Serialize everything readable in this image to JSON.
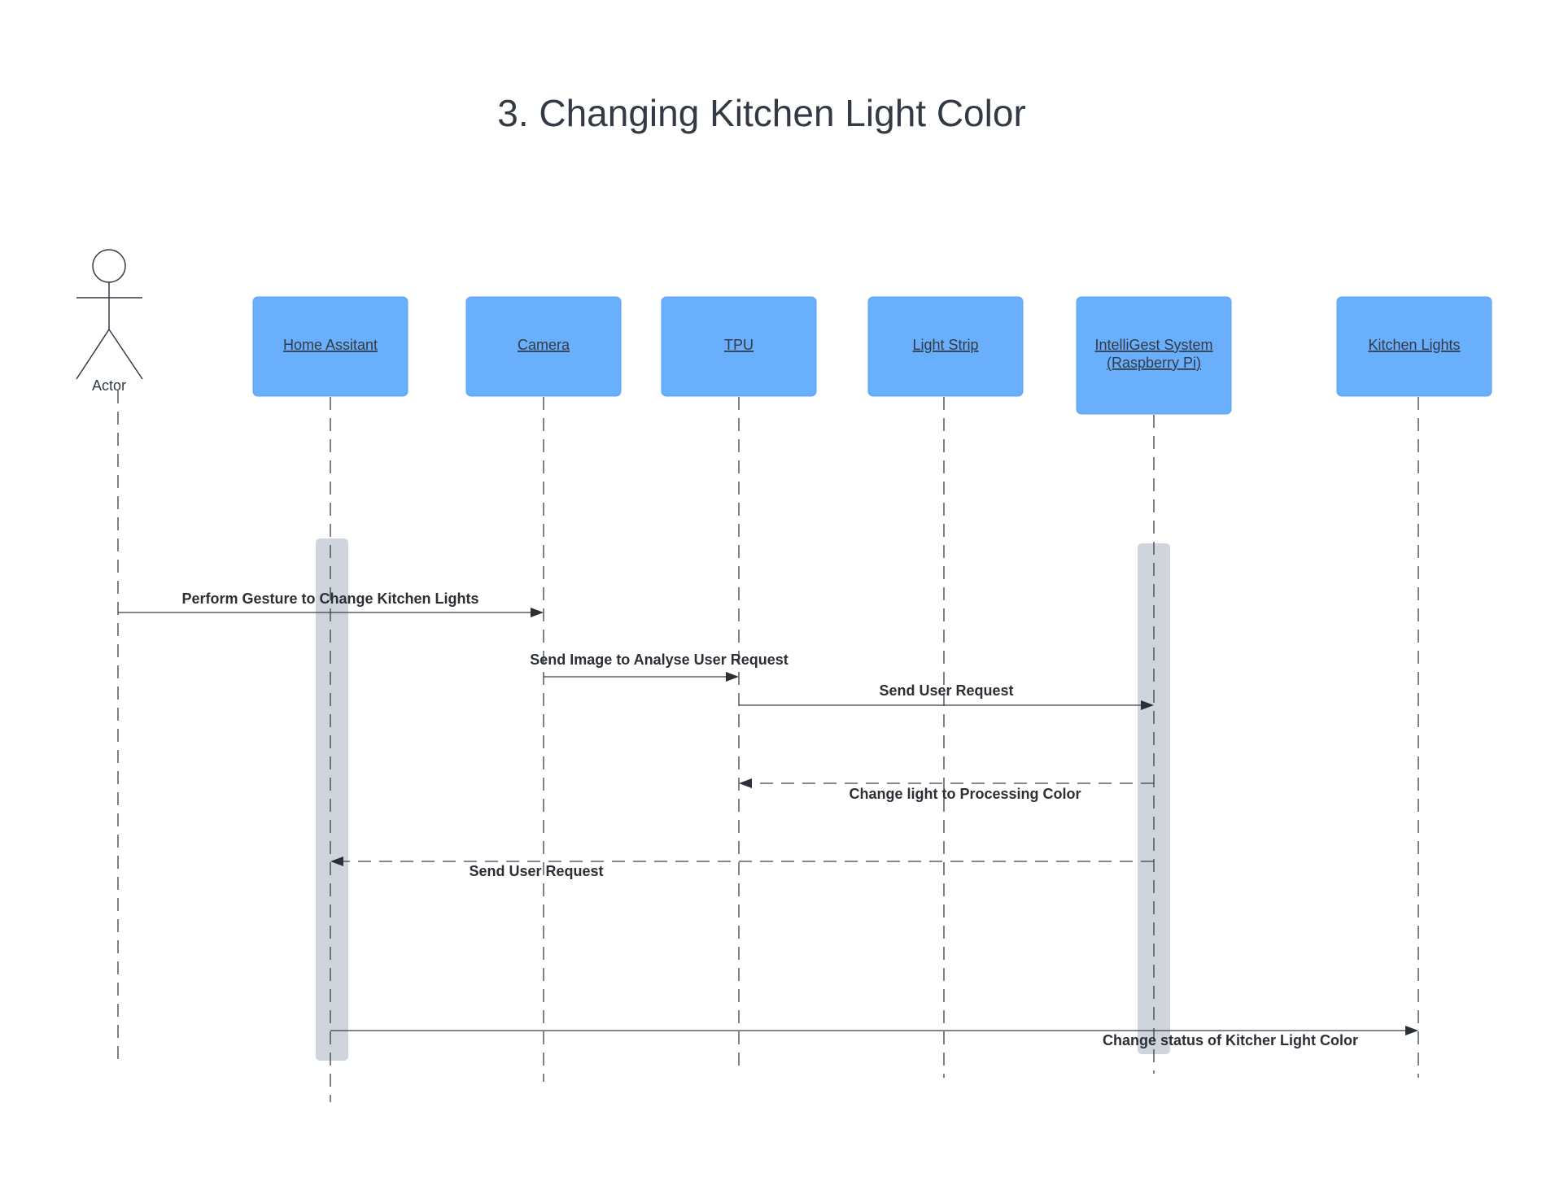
{
  "title": "3. Changing Kitchen Light Color",
  "actor": {
    "label": "Actor"
  },
  "participants": [
    {
      "id": "home",
      "lines": [
        "Home Assitant"
      ]
    },
    {
      "id": "camera",
      "lines": [
        "Camera"
      ]
    },
    {
      "id": "tpu",
      "lines": [
        "TPU"
      ]
    },
    {
      "id": "strip",
      "lines": [
        "Light Strip"
      ]
    },
    {
      "id": "intelligest",
      "lines": [
        "IntelliGest System",
        "(Raspberry Pi)"
      ]
    },
    {
      "id": "kitchen",
      "lines": [
        "Kitchen Lights"
      ]
    }
  ],
  "messages": [
    {
      "from": "actor",
      "to": "camera",
      "style": "solid",
      "label": "Perform Gesture to Change Kitchen Lights"
    },
    {
      "from": "camera",
      "to": "tpu",
      "style": "solid",
      "label": "Send Image to Analyse User Request"
    },
    {
      "from": "tpu",
      "to": "intelligest",
      "style": "solid",
      "label": "Send User Request"
    },
    {
      "from": "intelligest",
      "to": "tpu",
      "style": "dashed",
      "label": "Change light to Processing Color"
    },
    {
      "from": "intelligest",
      "to": "home",
      "style": "dashed",
      "label": "Send User Request"
    },
    {
      "from": "home",
      "to": "kitchen",
      "style": "solid",
      "label": "Change status of Kitcher Light Color"
    }
  ],
  "colors": {
    "box_fill": "#6aaffc",
    "activation_fill": "#d0d4dc",
    "line": "#3a3f47",
    "text": "#333a45"
  }
}
